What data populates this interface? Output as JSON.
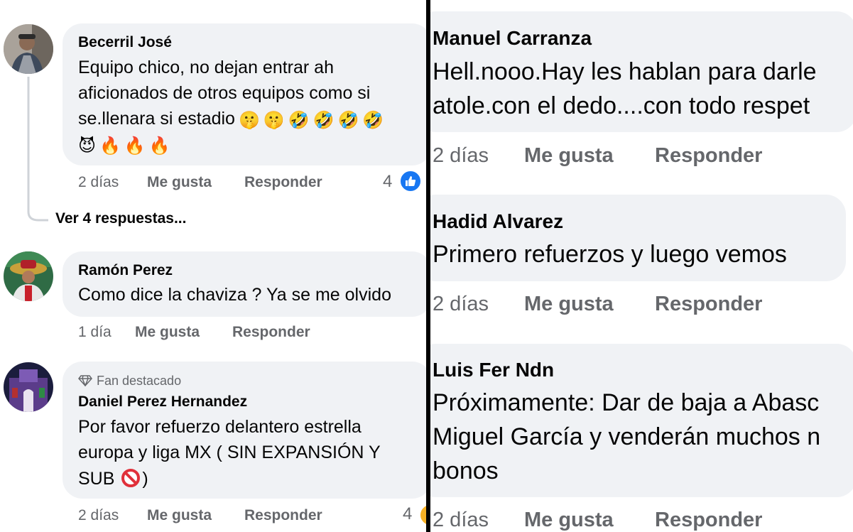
{
  "left": {
    "comments": [
      {
        "author": "Becerril José",
        "lines": [
          "Equipo chico, no dejan entrar ah",
          "aficionados de otros equipos como si",
          "se.llenara si estadio"
        ],
        "emoji_line_3": [
          "🤫",
          "🤫",
          "🤣",
          "🤣",
          "🤣",
          "🤣"
        ],
        "emoji_line_4": [
          "😈",
          "🔥",
          "🔥",
          "🔥"
        ],
        "time": "2 días",
        "like_label": "Me gusta",
        "reply_label": "Responder",
        "reaction_count": "4",
        "view_replies": "Ver 4 respuestas..."
      },
      {
        "author": "Ramón Perez",
        "lines": [
          "Como dice la chaviza ? Ya se me olvido"
        ],
        "time": "1 día",
        "like_label": "Me gusta",
        "reply_label": "Responder"
      },
      {
        "badge": "Fan destacado",
        "author": "Daniel Perez Hernandez",
        "lines": [
          "Por favor refuerzo delantero estrella",
          "europa y liga MX ( SIN EXPANSIÓN Y",
          "SUB"
        ],
        "line3_end": ")",
        "time": "2 días",
        "like_label": "Me gusta",
        "reply_label": "Responder",
        "reaction_count": "4"
      }
    ]
  },
  "right": {
    "comments": [
      {
        "author": "Manuel Carranza",
        "lines": [
          "Hell.nooo.Hay les hablan para darle",
          "atole.con el dedo....con todo respet"
        ],
        "time": "2 días",
        "like_label": "Me gusta",
        "reply_label": "Responder"
      },
      {
        "author": "Hadid Alvarez",
        "lines": [
          "Primero refuerzos y luego vemos"
        ],
        "time": "2 días",
        "like_label": "Me gusta",
        "reply_label": "Responder"
      },
      {
        "author": "Luis Fer Ndn",
        "lines": [
          "Próximamente: Dar de baja a Abasc",
          "Miguel García y venderán muchos n",
          "bonos"
        ],
        "time": "2 días",
        "like_label": "Me gusta",
        "reply_label": "Responder"
      }
    ]
  },
  "colors": {
    "bubble": "#f0f2f5",
    "meta_text": "#65676b",
    "like_blue": "#1877f2",
    "divider": "#000000"
  },
  "icons": [
    "like-reaction-icon",
    "diamond-icon",
    "no-entry-icon",
    "avatar-photo"
  ]
}
